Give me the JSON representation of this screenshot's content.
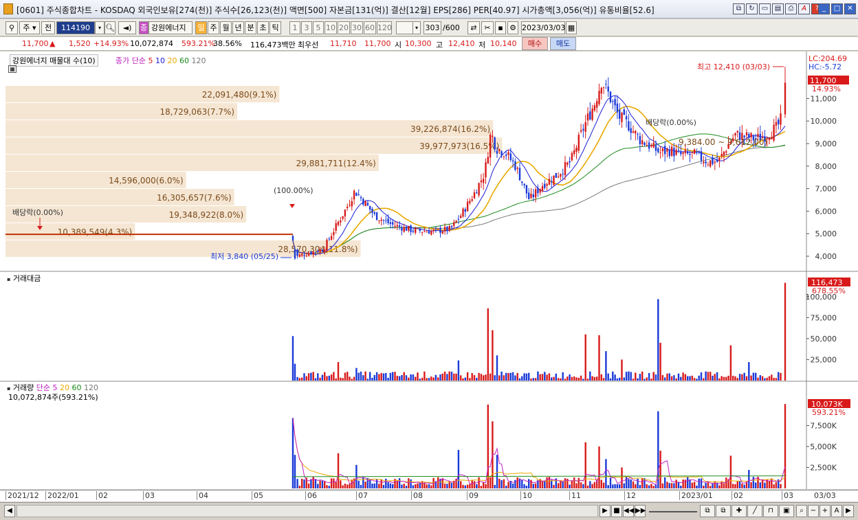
{
  "window": {
    "title": "[0601] 주식종합차트 - KOSDAQ 외국인보유[274(천)] 주식수[26,123(천)] 액면[500] 자본금[131(억)] 결산[12월] EPS[286] PER[40.97] 시가총액[3,056(억)] 유통비율[52.6]"
  },
  "toolbar": {
    "period_select": "주",
    "prev_label": "전",
    "stock_code": "114190",
    "stock_name": "강원에너지",
    "stock_prefix": "종",
    "periods": [
      "일",
      "주",
      "월",
      "년",
      "분",
      "초",
      "틱"
    ],
    "intervals": [
      "1",
      "3",
      "5",
      "10",
      "20",
      "30",
      "60",
      "120"
    ],
    "count": "303",
    "count_total": "/600",
    "date": "2023/03/03"
  },
  "quote": {
    "price": "11,700",
    "change": "1,520",
    "change_pct": "+14.93%",
    "volume": "10,072,874",
    "volume_pct": "593.21%",
    "turnover": "38.56%",
    "amount": "116,473백만",
    "priority_label": "최우선",
    "ask": "11,710",
    "bid": "11,700",
    "open_label": "시",
    "open": "10,300",
    "high_label": "고",
    "high": "12,410",
    "low_label": "저",
    "low": "10,140",
    "buy_label": "매수",
    "sell_label": "매도"
  },
  "price_pane": {
    "header": "강원에너지 매물대 수(10)",
    "ma_label": "종가 단순",
    "ma_periods": [
      "5",
      "10",
      "20",
      "60",
      "120"
    ],
    "ma_colors": [
      "#d81a1a",
      "#1a1ad8",
      "#e8a800",
      "#1a8a1a",
      "#777777"
    ],
    "lc_label": "LC:204.69",
    "hc_label": "HC:-5.72",
    "current_price_tag": "11,700",
    "current_pct_tag": "14.93%",
    "high_note": "최고 12,410 (03/03)",
    "low_note": "최저 3,840 (05/25)",
    "dividend_left": "배당락(0.00%)",
    "dividend_right": "배당락(0.00%)",
    "split_note": "(100.00%)",
    "range_note": "9,384.00 ~ 9,612.00)",
    "y_ticks": [
      "11,000",
      "10,000",
      "9,000",
      "8,000",
      "7,000",
      "6,000",
      "5,000",
      "4,000"
    ],
    "volume_profile": [
      {
        "label": "28,570,304(11.8%)",
        "width_pct": 11.8
      },
      {
        "label": "10,389,549(4.3%)",
        "width_pct": 4.3
      },
      {
        "label": "19,348,922(8.0%)",
        "width_pct": 8.0
      },
      {
        "label": "16,305,657(7.6%)",
        "width_pct": 7.6
      },
      {
        "label": "14,596,000(6.0%)",
        "width_pct": 6.0
      },
      {
        "label": "29,881,711(12.4%)",
        "width_pct": 12.4
      },
      {
        "label": "39,977,973(16.5%)",
        "width_pct": 16.5
      },
      {
        "label": "39,226,874(16.2%)",
        "width_pct": 16.2
      },
      {
        "label": "18,729,063(7.7%)",
        "width_pct": 7.7
      },
      {
        "label": "22,091,480(9.1%)",
        "width_pct": 9.1
      }
    ]
  },
  "amount_pane": {
    "header": "거래대금",
    "value_tag": "116,473",
    "pct_tag": "678.55%",
    "y_ticks": [
      "100,000",
      "75,000",
      "50,000",
      "25,000"
    ]
  },
  "volume_pane": {
    "header": "거래량",
    "ma_label": "단순",
    "ma_periods": [
      "5",
      "20",
      "60",
      "120"
    ],
    "ma_colors": [
      "#c020c0",
      "#e8a800",
      "#1a8a1a",
      "#777777"
    ],
    "value_line": "10,072,874주(593.21%)",
    "value_tag": "10,073K",
    "pct_tag": "593.21%",
    "y_ticks": [
      "7,500K",
      "5,000K",
      "2,500K"
    ]
  },
  "x_axis": {
    "labels": [
      "2021/12",
      "2022/01",
      "02",
      "03",
      "04",
      "05",
      "06",
      "07",
      "08",
      "09",
      "10",
      "11",
      "12",
      "2023/01",
      "02",
      "03"
    ],
    "right_label": "03/03"
  },
  "colors": {
    "up": "#d81a1a",
    "down": "#1a3ad8",
    "profile": "#f5e6d3"
  }
}
